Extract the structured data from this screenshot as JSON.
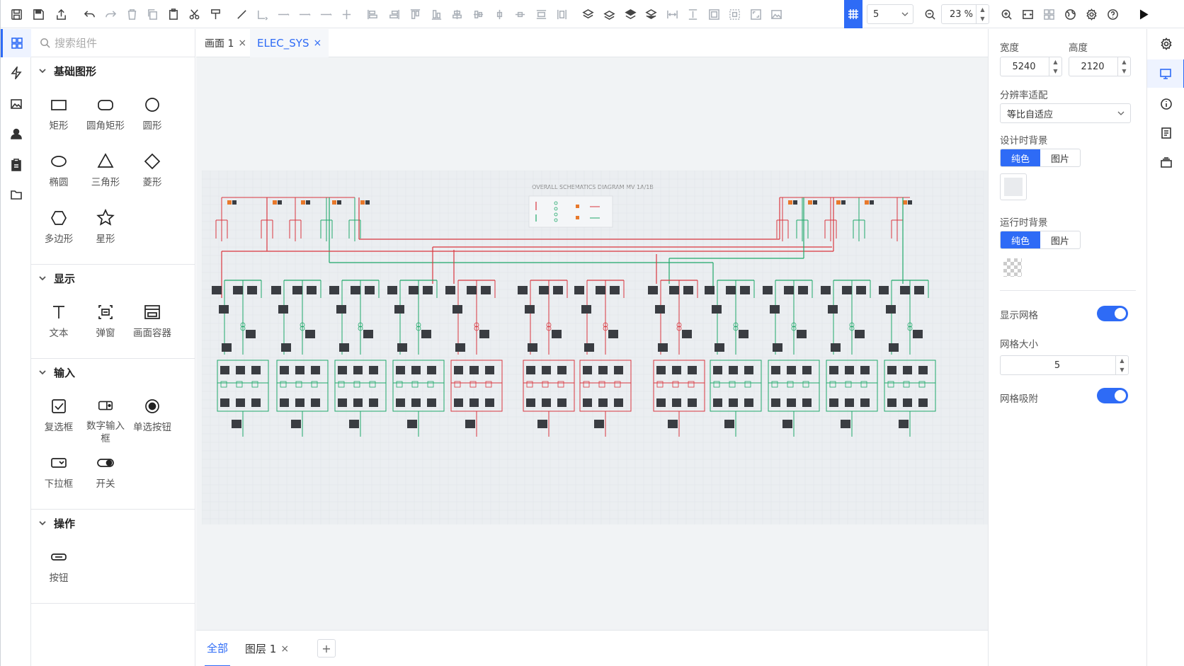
{
  "toolbar": {
    "grid_size": "5",
    "zoom": "23 %"
  },
  "panel": {
    "search_placeholder": "搜索组件",
    "sections": [
      {
        "title": "基础图形",
        "items": [
          "矩形",
          "圆角矩形",
          "圆形",
          "椭圆",
          "三角形",
          "菱形",
          "多边形",
          "星形"
        ]
      },
      {
        "title": "显示",
        "items": [
          "文本",
          "弹窗",
          "画面容器"
        ]
      },
      {
        "title": "输入",
        "items": [
          "复选框",
          "数字输入框",
          "单选按钮",
          "下拉框",
          "开关"
        ]
      },
      {
        "title": "操作",
        "items": [
          "按钮"
        ]
      }
    ]
  },
  "tabs": [
    {
      "label": "画面 1",
      "close": "×"
    },
    {
      "label": "ELEC_SYS",
      "close": "×"
    }
  ],
  "diagram": {
    "title": "OVERALL SCHEMATICS DIAGRAM MV 1A/1B"
  },
  "bottom_tabs": [
    {
      "label": "全部"
    },
    {
      "label": "图层 1",
      "close": "×"
    }
  ],
  "add_tab": "+",
  "props": {
    "width_label": "宽度",
    "width_value": "5240",
    "height_label": "高度",
    "height_value": "2120",
    "resolution_label": "分辨率适配",
    "resolution_value": "等比自适应",
    "design_bg_label": "设计时背景",
    "runtime_bg_label": "运行时背景",
    "seg_solid": "纯色",
    "seg_image": "图片",
    "show_grid_label": "显示网格",
    "grid_size_label": "网格大小",
    "grid_size_value": "5",
    "grid_snap_label": "网格吸附"
  },
  "colors": {
    "accent": "#2e6bf6",
    "line_red": "#d9363e",
    "line_green": "#1fa86a",
    "device_dark": "#3a3d42"
  }
}
